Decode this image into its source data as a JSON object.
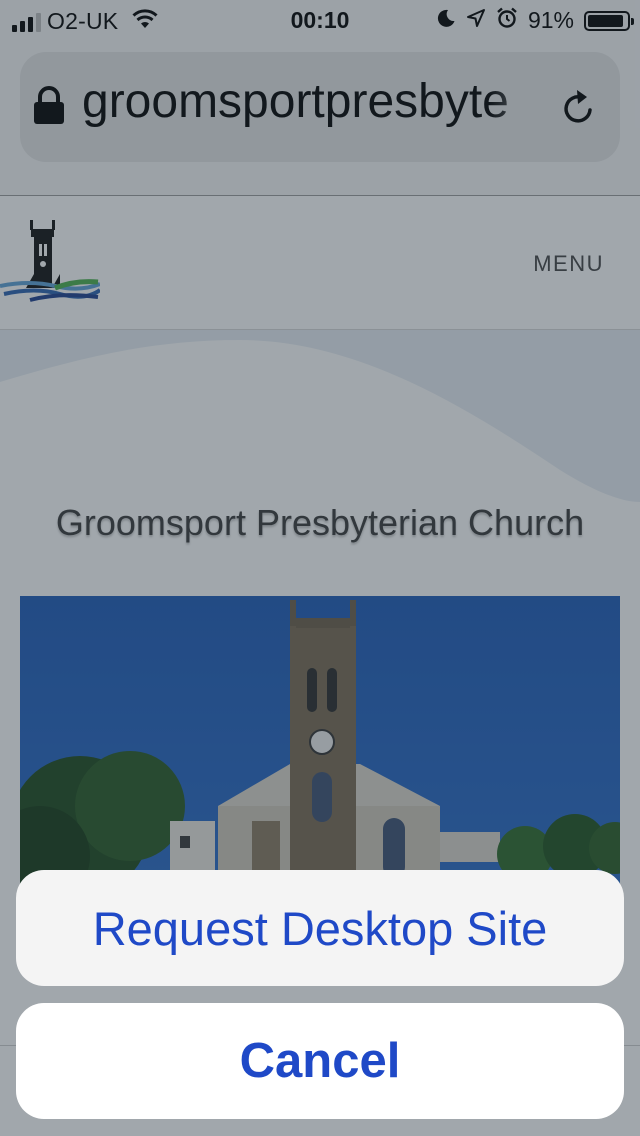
{
  "status_bar": {
    "carrier": "O2-UK",
    "time": "00:10",
    "battery_percent": "91%",
    "battery_level": 0.91,
    "signal_bars": 3,
    "icons": [
      "signal-icon",
      "wifi-icon",
      "moon-icon",
      "location-icon",
      "alarm-icon",
      "battery-icon"
    ]
  },
  "browser": {
    "url": "groomsportpresbyte",
    "lock_icon": "lock-icon",
    "reload_icon": "reload-icon"
  },
  "site": {
    "menu_label": "MENU",
    "title": "Groomsport Presbyterian Church",
    "logo_icon": "church-tower-logo"
  },
  "action_sheet": {
    "request_desktop_label": "Request Desktop Site",
    "cancel_label": "Cancel"
  },
  "colors": {
    "action_text": "#1f49c7",
    "overlay": "rgba(40,54,66,0.44)"
  }
}
